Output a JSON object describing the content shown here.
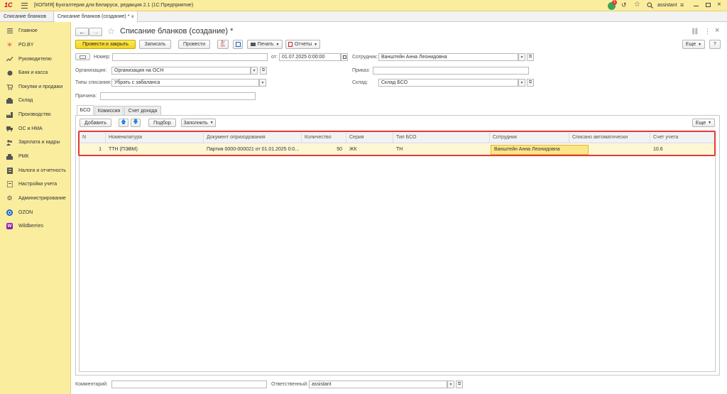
{
  "app": {
    "logo": "1С",
    "title": "[КОПИЯ] Бухгалтерия для Беларуси, редакция 2.1  (1С:Предприятие)",
    "notify_count": "1",
    "user": "assistant"
  },
  "open_tabs": [
    {
      "label": "Списание бланков"
    },
    {
      "label": "Списание бланков (создание) *",
      "close": "×"
    }
  ],
  "sidebar": {
    "items": [
      {
        "label": "Главное",
        "icon": "menu-icon"
      },
      {
        "label": "PO.BY",
        "icon": "snowflake-icon"
      },
      {
        "label": "Руководителю",
        "icon": "chart-icon"
      },
      {
        "label": "Банк и касса",
        "icon": "bank-icon"
      },
      {
        "label": "Покупки и продажи",
        "icon": "cart-icon"
      },
      {
        "label": "Склад",
        "icon": "warehouse-icon"
      },
      {
        "label": "Производство",
        "icon": "factory-icon"
      },
      {
        "label": "ОС и НМА",
        "icon": "truck-icon"
      },
      {
        "label": "Зарплата и кадры",
        "icon": "people-icon"
      },
      {
        "label": "РМК",
        "icon": "register-icon"
      },
      {
        "label": "Налоги и отчетность",
        "icon": "taxes-icon"
      },
      {
        "label": "Настройки учета",
        "icon": "settings-doc-icon"
      },
      {
        "label": "Администрирование",
        "icon": "gear-icon"
      },
      {
        "label": "OZON",
        "icon": "ozon-icon"
      },
      {
        "label": "Wildberries",
        "icon": "wildberries-icon"
      }
    ]
  },
  "form": {
    "title": "Списание бланков (создание) *",
    "buttons": {
      "post_close": "Провести и закрыть",
      "save": "Записать",
      "post": "Провести",
      "print": "Печать",
      "reports": "Отчеты",
      "more": "Еще",
      "help": "?"
    },
    "labels": {
      "number": "Номер:",
      "from": "от:",
      "employee": "Сотрудник:",
      "organization": "Организация:",
      "order": "Приказ:",
      "writeoff_type": "Типы списания:",
      "warehouse": "Склад:",
      "reason": "Причина:",
      "comment": "Комментарий:",
      "responsible": "Ответственный:"
    },
    "values": {
      "number": "",
      "date": "01.07.2025  0:00:00",
      "employee": "Ванштейн Анна Леонидовна",
      "organization": "Организация на ОСН",
      "order": "",
      "writeoff_type": "Убрать с забаланса",
      "warehouse": "Склад БСО",
      "reason": "",
      "comment": "",
      "responsible": "assistant"
    }
  },
  "doc_tabs": [
    {
      "label": "БСО"
    },
    {
      "label": "Комиссия"
    },
    {
      "label": "Счет дохода"
    }
  ],
  "table_toolbar": {
    "add": "Добавить",
    "pick": "Подбор",
    "fill": "Заполнить",
    "more": "Еще"
  },
  "table": {
    "columns": [
      "N",
      "Номенклатура",
      "Документ оприходования",
      "Количество",
      "Серия",
      "Тип БСО",
      "Сотрудник",
      "Списано автоматически",
      "Счет учета"
    ],
    "rows": [
      [
        "1",
        "ТТН (ПЭВМ)",
        "Партия 0000-000021 от 01.01.2025 0:0...",
        "50",
        "ЖК",
        "ТН",
        "Ванштейн Анна Леонидовна",
        "",
        "10.6"
      ]
    ]
  },
  "colors": {
    "accent_yellow": "#fbed9e",
    "button_yellow": "#f5d41b",
    "selection_red": "#e53935",
    "row_highlight": "#fff6d3"
  }
}
